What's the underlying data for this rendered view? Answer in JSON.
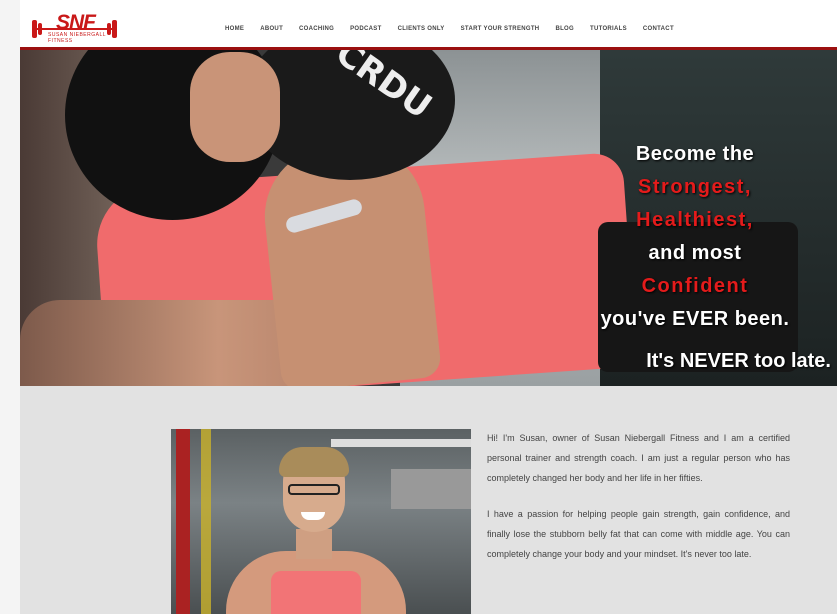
{
  "brand": {
    "logo_text": "SNF",
    "logo_sub": "SUSAN NIEBERGALL FITNESS",
    "brand_color": "#c91818"
  },
  "nav": {
    "items": [
      "HOME",
      "ABOUT",
      "COACHING",
      "PODCAST",
      "CLIENTS ONLY",
      "START YOUR STRENGTH",
      "BLOG",
      "TUTORIALS",
      "CONTACT"
    ]
  },
  "hero": {
    "lines": [
      {
        "text": "Become the",
        "style": "white"
      },
      {
        "text": "Strongest,",
        "style": "red"
      },
      {
        "text": "Healthiest,",
        "style": "red"
      },
      {
        "text": "and most",
        "style": "white"
      },
      {
        "text": "Confident",
        "style": "red"
      },
      {
        "text": "you've EVER been.",
        "style": "white"
      }
    ],
    "tagline": "It's NEVER too late.",
    "dumbbell_text": "CRDU",
    "accent_red": "#e41b1b"
  },
  "about": {
    "paragraphs": [
      "Hi! I'm Susan, owner of Susan Niebergall Fitness and I am a certified personal trainer and strength coach. I am just a regular person who has completely changed her body and her life in her fifties.",
      "I have a passion for helping people gain strength, gain confidence, and finally lose the stubborn belly fat that can come with middle age. You can completely change your body and your mindset. It's never too late."
    ]
  }
}
